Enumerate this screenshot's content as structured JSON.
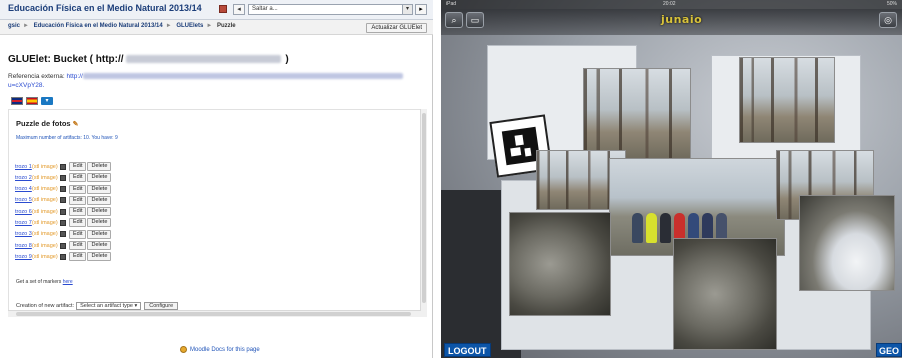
{
  "left": {
    "course_title": "Educación Física en el Medio Natural 2013/14",
    "jump_placeholder": "Saltar a...",
    "breadcrumbs": [
      "gsic",
      "Educación Física en el Medio Natural 2013/14",
      "GLUElets",
      "Puzzle"
    ],
    "update_button": "Actualizar GLUElet",
    "gluelet_title_prefix": "GLUElet: Bucket ( http://",
    "gluelet_title_suffix": " )",
    "external_ref_label": "Referencia externa:",
    "external_ref_link_prefix": "http://",
    "external_ref_link_tail": "u=cXVpY28.",
    "puzzle_title": "Puzzle de fotos",
    "max_info": "Maximum number of artifacts: 10. You have: 9",
    "rows": [
      {
        "name": "trozo 1",
        "tag": "(stl image)"
      },
      {
        "name": "trozo 2",
        "tag": "(stl image)"
      },
      {
        "name": "trozo 4",
        "tag": "(stl image)"
      },
      {
        "name": "trozo 5",
        "tag": "(stl image)"
      },
      {
        "name": "trozo 6",
        "tag": "(stl image)"
      },
      {
        "name": "trozo 7",
        "tag": "(stl image)"
      },
      {
        "name": "trozo 3",
        "tag": "(stl image)"
      },
      {
        "name": "trozo 8",
        "tag": "(stl image)"
      },
      {
        "name": "trozo 9",
        "tag": "(stl image)"
      }
    ],
    "edit_label": "Edit",
    "delete_label": "Delete",
    "markers_text": "Get a set of markers",
    "markers_link": "here",
    "creation_label": "Creation of new artifact:",
    "creation_select": "Select an artifact type",
    "configure_button": "Configure",
    "docs_link": "Moodle Docs for this page"
  },
  "right": {
    "status_left": "iPad",
    "status_time": "20:02",
    "status_right": "50%",
    "logo_text": "junaio",
    "logout_button": "LOGOUT",
    "geo_button": "GEO",
    "search_icon": "search-icon",
    "screen_icon": "screen-icon",
    "scan_icon": "scan-icon"
  }
}
